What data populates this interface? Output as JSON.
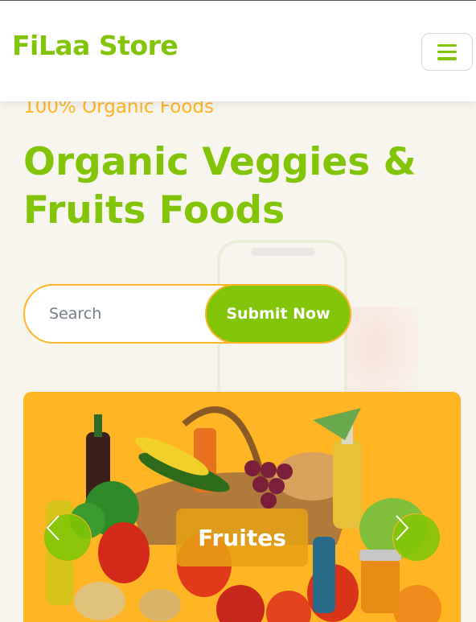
{
  "navbar": {
    "brand": "FiLaa Store",
    "menu_icon": "hamburger-menu-icon"
  },
  "hero": {
    "eyebrow": "100% Organic Foods",
    "headline": "Organic Veggies & Fruits Foods",
    "search": {
      "placeholder": "Search"
    },
    "submit_label": "Submit Now"
  },
  "carousel": {
    "caption": "Fruites",
    "prev_icon": "chevron-left-icon",
    "next_icon": "chevron-right-icon"
  },
  "colors": {
    "primary": "#81c408",
    "secondary": "#ffb524",
    "background": "#f8f4ee"
  }
}
